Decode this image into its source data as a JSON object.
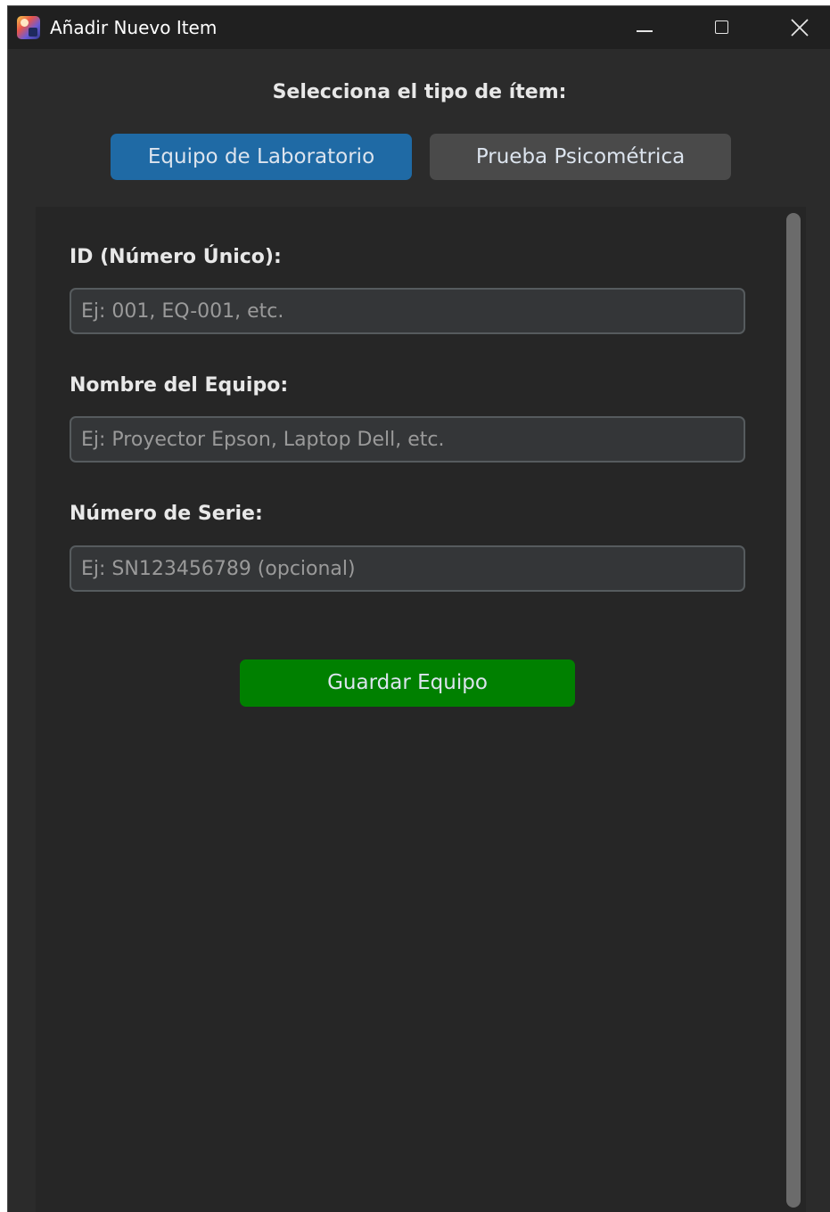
{
  "window": {
    "title": "Añadir Nuevo Item"
  },
  "header": {
    "prompt": "Selecciona el tipo de ítem:"
  },
  "type_selector": {
    "options": [
      {
        "label": "Equipo de Laboratorio",
        "selected": true
      },
      {
        "label": "Prueba Psicométrica",
        "selected": false
      }
    ]
  },
  "form": {
    "fields": [
      {
        "label": "ID (Número Único):",
        "placeholder": "Ej: 001, EQ-001, etc.",
        "value": ""
      },
      {
        "label": "Nombre del Equipo:",
        "placeholder": "Ej: Proyector Epson, Laptop Dell, etc.",
        "value": ""
      },
      {
        "label": "Número de Serie:",
        "placeholder": "Ej: SN123456789 (opcional)",
        "value": ""
      }
    ],
    "save_label": "Guardar Equipo"
  },
  "colors": {
    "selected_button": "#1f6aa5",
    "unselected_button": "#4a4a4a",
    "save_button": "#008000",
    "background": "#2b2b2b"
  },
  "icons": {
    "app": "app-icon",
    "minimize": "minimize-icon",
    "maximize": "maximize-icon",
    "close": "close-icon"
  }
}
